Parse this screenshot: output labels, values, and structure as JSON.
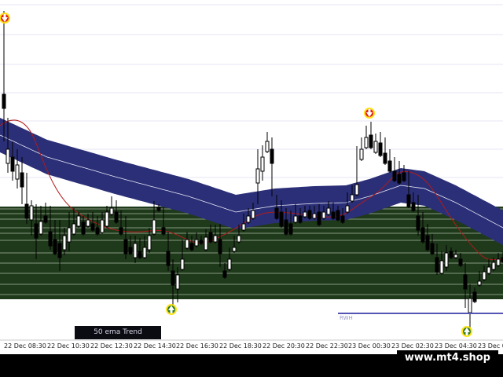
{
  "chart": {
    "time_labels": [
      "22 Dec 08:30",
      "22 Dec 10:30",
      "22 Dec 12:30",
      "22 Dec 14:30",
      "22 Dec 16:30",
      "22 Dec 18:30",
      "22 Dec 20:30",
      "22 Dec 22:30",
      "23 Dec 00:30",
      "23 Dec 02:30",
      "23 Dec 04:30",
      "23 Dec 0"
    ],
    "indicator_label": "50 ema Trend",
    "horizontal_line_label": "RWH",
    "watermark": "www.mt4.shop",
    "colors": {
      "background": "#ffffff",
      "ema_band": "#2b2f77",
      "zone": "#1f3a1b",
      "zone_line": "#d8e2d2",
      "candle": "#000000",
      "red_line": "#b21b1b",
      "horizontal_line": "#5454b4",
      "sell_signal": "#e01a1a",
      "buy_signal": "#2a7a2a"
    },
    "icons": [
      "sell-arrow-icon",
      "sell-arrow-icon",
      "buy-arrow-icon",
      "buy-arrow-icon"
    ]
  }
}
